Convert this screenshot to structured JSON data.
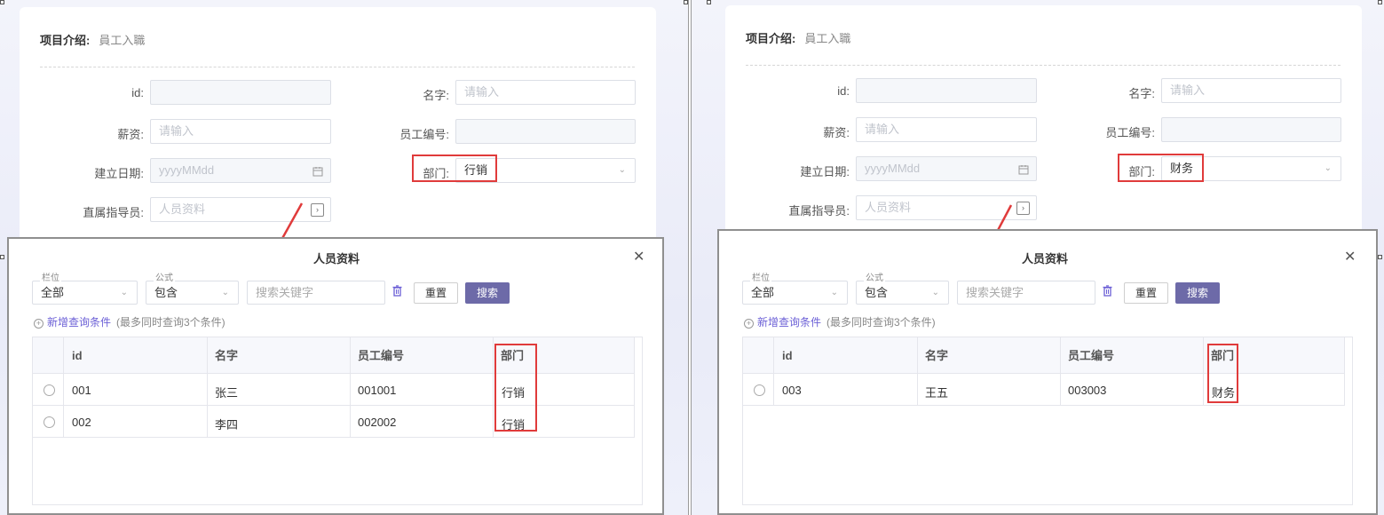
{
  "panels": [
    {
      "form": {
        "project_label": "项目介绍:",
        "project_value": "員工入職",
        "id_label": "id:",
        "name_label": "名字:",
        "name_placeholder": "请输入",
        "salary_label": "薪资:",
        "salary_placeholder": "请输入",
        "empno_label": "员工编号:",
        "date_label": "建立日期:",
        "date_placeholder": "yyyyMMdd",
        "dept_label": "部门:",
        "dept_value": "行销",
        "mentor_label": "直属指导员:",
        "mentor_placeholder": "人员资料"
      },
      "modal": {
        "title": "人员资料",
        "field_legend": "栏位",
        "field_value": "全部",
        "op_legend": "公式",
        "op_value": "包含",
        "search_placeholder": "搜索关键字",
        "reset_label": "重置",
        "search_label": "搜索",
        "add_condition": "新增查询条件",
        "add_condition_hint": "(最多同时查询3个条件)",
        "columns": [
          "id",
          "名字",
          "员工编号",
          "部门"
        ],
        "rows": [
          {
            "id": "001",
            "name": "张三",
            "empno": "001001",
            "dept": "行销"
          },
          {
            "id": "002",
            "name": "李四",
            "empno": "002002",
            "dept": "行销"
          }
        ]
      }
    },
    {
      "form": {
        "project_label": "项目介绍:",
        "project_value": "員工入職",
        "id_label": "id:",
        "name_label": "名字:",
        "name_placeholder": "请输入",
        "salary_label": "薪资:",
        "salary_placeholder": "请输入",
        "empno_label": "员工编号:",
        "date_label": "建立日期:",
        "date_placeholder": "yyyyMMdd",
        "dept_label": "部门:",
        "dept_value": "财务",
        "mentor_label": "直属指导员:",
        "mentor_placeholder": "人员资料"
      },
      "modal": {
        "title": "人员资料",
        "field_legend": "栏位",
        "field_value": "全部",
        "op_legend": "公式",
        "op_value": "包含",
        "search_placeholder": "搜索关键字",
        "reset_label": "重置",
        "search_label": "搜索",
        "add_condition": "新增查询条件",
        "add_condition_hint": "(最多同时查询3个条件)",
        "columns": [
          "id",
          "名字",
          "员工编号",
          "部门"
        ],
        "rows": [
          {
            "id": "003",
            "name": "王五",
            "empno": "003003",
            "dept": "财务"
          }
        ]
      }
    }
  ],
  "icons": {
    "calendar": "calendar-icon",
    "lookup": "lookup-icon",
    "chevron": "chevron-down-icon",
    "close": "close-icon",
    "trash": "trash-icon",
    "plus": "plus-circle-icon",
    "radio": "radio-icon"
  },
  "colors": {
    "annotation_red": "#e03b3b",
    "accent": "#6b5fd6",
    "search_button": "#6d6aa8"
  }
}
